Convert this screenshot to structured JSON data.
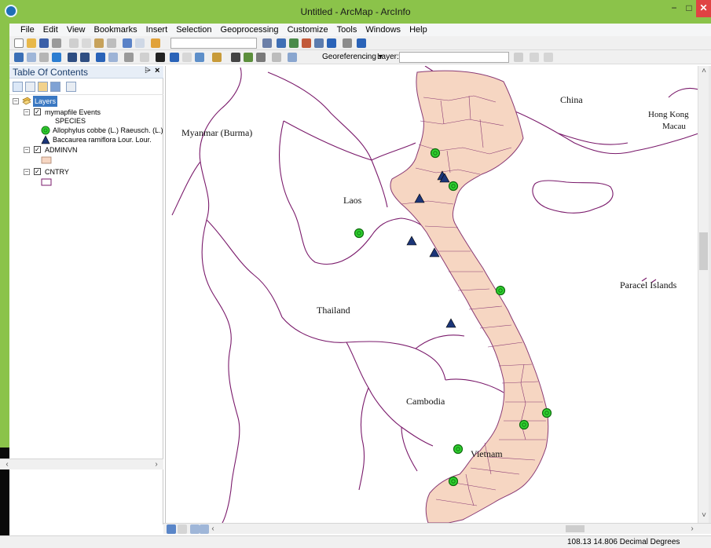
{
  "window": {
    "title": "Untitled - ArcMap - ArcInfo",
    "minimize_label": "−",
    "maximize_label": "□",
    "close_label": "✕"
  },
  "menu": [
    "File",
    "Edit",
    "View",
    "Bookmarks",
    "Insert",
    "Selection",
    "Geoprocessing",
    "Customize",
    "Tools",
    "Windows",
    "Help"
  ],
  "toolbars": {
    "georeferencing_label": "Georeferencing ▾",
    "layer_label": "Layer:",
    "layer_value": ""
  },
  "toc": {
    "title": "Table Of Contents",
    "pin_glyph": "⩥",
    "close_glyph": "×",
    "tree": {
      "root_label": "Layers",
      "layer1": "mymapfile Events",
      "field_header": "SPECIES",
      "legend1": "Allophylus cobbe (L.) Raeusch.  (L.)",
      "legend2": "Baccaurea ramiflora Lour.  Lour.",
      "layer2": "ADMINVN",
      "layer3": "CNTRY"
    }
  },
  "map": {
    "labels": {
      "china": "China",
      "hongkong": "Hong Kong",
      "macau": "Macau",
      "myanmar": "Myanmar (Burma)",
      "laos": "Laos",
      "thailand": "Thailand",
      "paracel": "Paracel Islands",
      "cambodia": "Cambodia",
      "vietnam": "Vietnam"
    },
    "colors": {
      "country_outline": "#7a1a6b",
      "vietnam_fill": "#f6d6c2",
      "vietnam_border": "#8a3a74",
      "circle_fill": "#2fd12f",
      "triangle_fill": "#1b3578"
    }
  },
  "status": {
    "coordinates": "108.13  14.806 Decimal Degrees"
  }
}
